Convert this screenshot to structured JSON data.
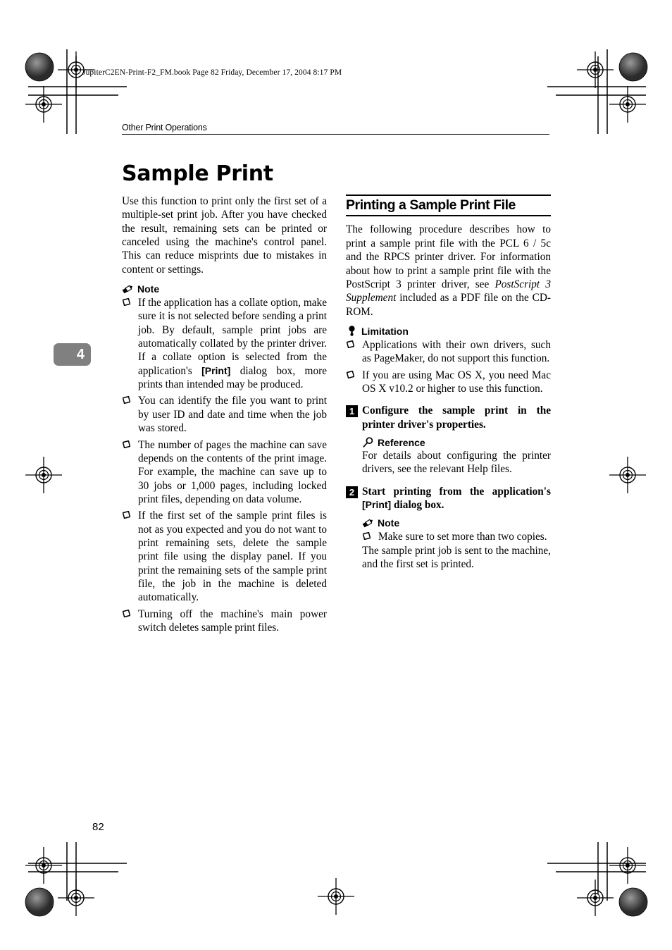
{
  "page": {
    "file_info": "JupiterC2EN-Print-F2_FM.book  Page 82  Friday, December 17, 2004  8:17 PM",
    "running_header": "Other Print Operations",
    "chapter_tab": "4",
    "page_number": "82",
    "title": "Sample Print"
  },
  "left_column": {
    "intro": "Use this function to print only the first set of a multiple-set print job. After you have checked the result, remaining sets can be printed or canceled using the machine's control panel. This can reduce misprints due to mistakes in content or settings.",
    "note_label": "Note",
    "note_icon": "pencil-icon",
    "notes": [
      {
        "part1": "If the application has a collate option, make sure it is not selected before sending a print job. By default, sample print jobs are automatically collated by the printer driver. If a collate option is selected from the application's ",
        "emphasis": "[Print]",
        "part2": " dialog box, more prints than intended may be produced."
      },
      {
        "part1": "You can identify the file you want to print by user ID and date and time when the job was stored.",
        "emphasis": "",
        "part2": ""
      },
      {
        "part1": "The number of pages the machine can save depends on the contents of the print image. For example, the machine can save up to 30 jobs or 1,000 pages, including locked print files, depending on data volume.",
        "emphasis": "",
        "part2": ""
      },
      {
        "part1": "If the first set of the sample print files is not as you expected and you do not want to print remaining sets, delete the sample print file using the display panel. If you print the remaining sets of the sample print file, the job in the machine is deleted automatically.",
        "emphasis": "",
        "part2": ""
      },
      {
        "part1": "Turning off the machine's main power switch deletes sample print files.",
        "emphasis": "",
        "part2": ""
      }
    ]
  },
  "right_column": {
    "section_heading": "Printing a Sample Print File",
    "intro_part1": "The following procedure describes how to print a sample print file with the PCL 6 / 5c and the RPCS printer driver. For information about how to print a sample print file with the PostScript 3 printer driver, see ",
    "intro_italic": "PostScript 3 Supplement",
    "intro_part2": " included as a PDF file on the CD-ROM.",
    "limitation_label": "Limitation",
    "limitation_icon": "pin-icon",
    "limitations": [
      "Applications with their own drivers, such as PageMaker, do not support this function.",
      "If you are using Mac OS X, you need Mac OS X v10.2 or higher to use this function."
    ],
    "step1": {
      "number": "1",
      "text": "Configure the sample print in the printer driver's properties.",
      "reference_label": "Reference",
      "reference_icon": "magnifier-icon",
      "reference_text": "For details about configuring the printer drivers, see the relevant Help files."
    },
    "step2": {
      "number": "2",
      "text_part1": "Start printing from the application's ",
      "text_emphasis": "[Print]",
      "text_part2": " dialog box.",
      "note_label": "Note",
      "note_icon": "pencil-icon",
      "notes": [
        "Make sure to set more than two copies."
      ],
      "closing": "The sample print job is sent to the machine, and the first set is printed."
    }
  },
  "colors": {
    "chapter_tab_bg": "#808080",
    "text": "#000000",
    "rule": "#000000"
  }
}
